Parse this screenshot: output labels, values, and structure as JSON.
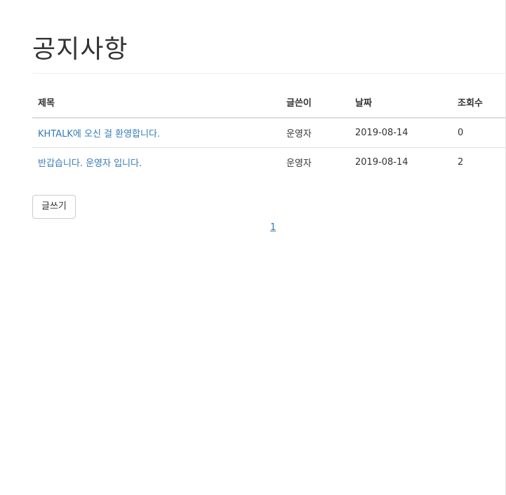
{
  "page_title": "공지사항",
  "table": {
    "headers": {
      "title": "제목",
      "writer": "글쓴이",
      "date": "날짜",
      "views": "조회수"
    },
    "rows": [
      {
        "title": "KHTALK에 오신 걸 환영합니다.",
        "writer": "운영자",
        "date": "2019-08-14",
        "views": "0"
      },
      {
        "title": "반갑습니다. 운영자 입니다.",
        "writer": "운영자",
        "date": "2019-08-14",
        "views": "2"
      }
    ]
  },
  "write_button_label": "글쓰기",
  "pagination": {
    "current_page": "1"
  },
  "colors": {
    "link": "#337ab7",
    "border": "#dddddd",
    "text": "#333333"
  }
}
